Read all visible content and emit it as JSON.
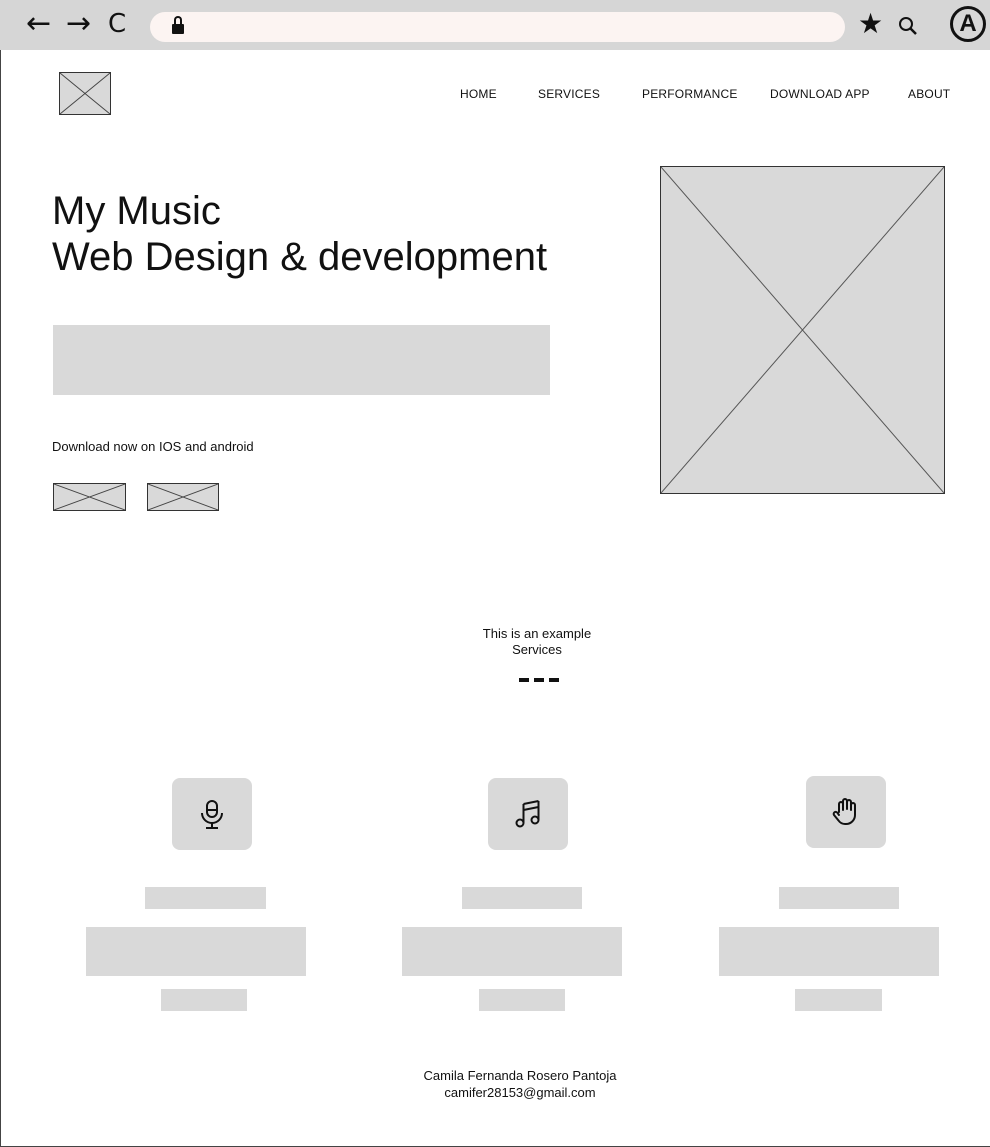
{
  "browser": {
    "back_icon": "←",
    "forward_icon": "→",
    "reload_icon": "C",
    "star_icon": "★",
    "search_icon": "⚲",
    "account_icon": "A"
  },
  "nav": {
    "items": [
      "HOME",
      "SERVICES",
      "PERFORMANCE",
      "DOWNLOAD APP",
      "ABOUT"
    ]
  },
  "hero": {
    "title_line1": "My Music",
    "title_line2": "Web Design & development",
    "download_text": "Download now on IOS and android"
  },
  "services": {
    "heading_line1": "This is an example",
    "heading_line2": "Services",
    "cards": [
      {
        "icon": "microphone-icon"
      },
      {
        "icon": "music-note-icon"
      },
      {
        "icon": "hand-icon"
      }
    ]
  },
  "footer": {
    "name": "Camila Fernanda Rosero Pantoja",
    "email": "camifer28153@gmail.com"
  }
}
